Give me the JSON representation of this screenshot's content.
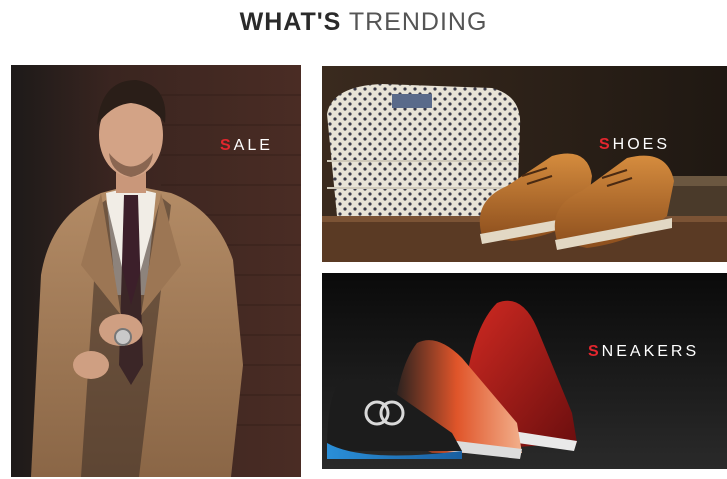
{
  "section": {
    "title_bold": "WHAT'S",
    "title_light": "TRENDING"
  },
  "tiles": [
    {
      "label_first": "S",
      "label_rest": "ALE"
    },
    {
      "label_first": "S",
      "label_rest": "HOES"
    },
    {
      "label_first": "S",
      "label_rest": "NEAKERS"
    }
  ],
  "colors": {
    "accent": "#e3262e",
    "label_text": "#ffffff",
    "title_text": "#2a2a2a"
  }
}
